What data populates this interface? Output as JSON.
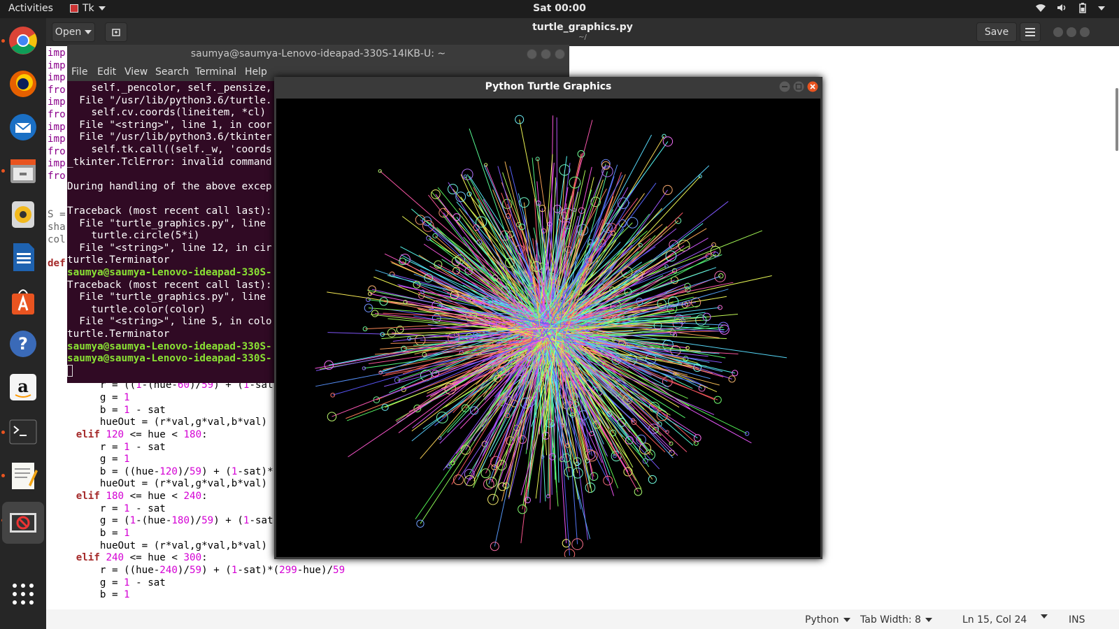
{
  "topbar": {
    "activities": "Activities",
    "app_name": "Tk",
    "clock": "Sat 00:00"
  },
  "dock": {
    "items": [
      "Chrome",
      "Firefox",
      "Thunderbird",
      "Files",
      "Rhythmbox",
      "LibreOffice Writer",
      "Ubuntu Software",
      "Help",
      "Amazon",
      "Terminal",
      "Text Editor",
      "Tk"
    ]
  },
  "gedit": {
    "open_label": "Open",
    "title": "turtle_graphics.py",
    "subtitle": "~/",
    "save_label": "Save",
    "left_fragments": [
      "imp",
      "imp",
      "imp",
      "fro",
      "imp",
      "fro",
      "imp",
      "imp",
      "fro",
      "imp",
      "fro"
    ],
    "fragment_s": "S =",
    "fragment_sha": "sha",
    "fragment_col": "col",
    "fragment_def": "def"
  },
  "status": {
    "language": "Python",
    "tab_width": "Tab Width: 8",
    "position": "Ln 15, Col 24",
    "mode": "INS"
  },
  "terminal": {
    "title": "saumya@saumya-Lenovo-ideapad-330S-14IKB-U: ~",
    "menu": [
      "File",
      "Edit",
      "View",
      "Search",
      "Terminal",
      "Help"
    ],
    "lines": [
      "    self._pencolor, self._pensize,",
      "  File \"/usr/lib/python3.6/turtle.",
      "    self.cv.coords(lineitem, *cl)",
      "  File \"<string>\", line 1, in coor",
      "  File \"/usr/lib/python3.6/tkinter",
      "    self.tk.call((self._w, 'coords",
      "_tkinter.TclError: invalid command",
      "",
      "During handling of the above excep",
      "",
      "Traceback (most recent call last):",
      "  File \"turtle_graphics.py\", line ",
      "    turtle.circle(5*i)",
      "  File \"<string>\", line 12, in cir",
      "turtle.Terminator",
      "saumya@saumya-Lenovo-ideapad-330S-",
      "Traceback (most recent call last):",
      "  File \"turtle_graphics.py\", line ",
      "    turtle.color(color)",
      "  File \"<string>\", line 5, in colo",
      "turtle.Terminator",
      "saumya@saumya-Lenovo-ideapad-330S-",
      "saumya@saumya-Lenovo-ideapad-330S-"
    ]
  },
  "turtle_window": {
    "title": "Python Turtle Graphics"
  },
  "colors": {
    "terminal_bg": "#300a24",
    "prompt": "#8ae234",
    "keyword": "#a52a2a",
    "number": "#d400d4",
    "close_button": "#e95420"
  }
}
